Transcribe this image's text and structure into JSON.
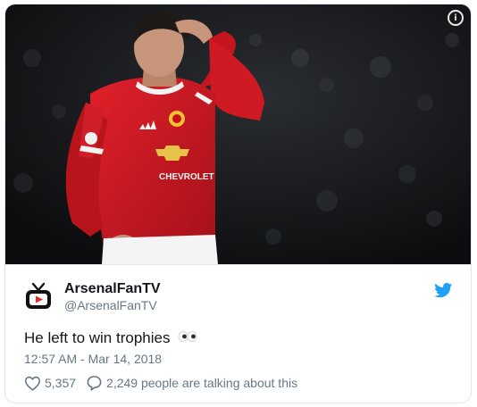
{
  "tweet": {
    "author_name": "ArsenalFanTV",
    "author_handle": "@ArsenalFanTV",
    "text": "He left to win trophies",
    "emoji": "eyes",
    "timestamp": "12:57 AM - Mar 14, 2018",
    "likes": "5,357",
    "talking": "2,249 people are talking about this",
    "brand_color": "#1da1f2",
    "media": {
      "description": "player in red jersey holding head",
      "sponsor_text": "CHEVROLET"
    }
  },
  "icons": {
    "info": "info-icon",
    "avatar": "tv-logo-icon",
    "twitter": "twitter-bird-icon",
    "like": "heart-icon",
    "reply": "speech-bubble-icon"
  }
}
